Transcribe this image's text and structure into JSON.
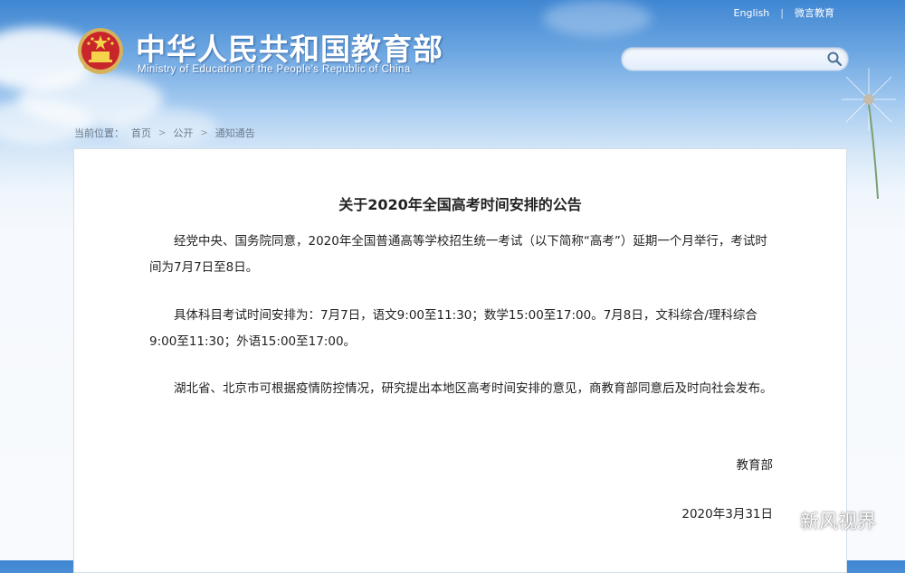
{
  "header": {
    "title_cn": "中华人民共和国教育部",
    "title_en": "Ministry of Education of the People's Republic of China",
    "english_link": "English",
    "separator": "|",
    "weibo_link": "微言教育",
    "search_placeholder": ""
  },
  "breadcrumb": {
    "label": "当前位置：",
    "items": [
      "首页",
      "公开",
      "通知通告"
    ],
    "arrow": ">"
  },
  "article": {
    "title": "关于2020年全国高考时间安排的公告",
    "paragraphs": [
      "经党中央、国务院同意，2020年全国普通高等学校招生统一考试（以下简称“高考”）延期一个月举行，考试时间为7月7日至8日。",
      "具体科目考试时间安排为：7月7日，语文9:00至11:30；数学15:00至17:00。7月8日，文科综合/理科综合9:00至11:30；外语15:00至17:00。",
      "湖北省、北京市可根据疫情防控情况，研究提出本地区高考时间安排的意见，商教育部同意后及时向社会发布。"
    ],
    "signature": "教育部",
    "date": "2020年3月31日"
  },
  "watermark": {
    "text": "新风视界",
    "icon": "wechat-icon"
  },
  "colors": {
    "sky_top": "#3f86d2",
    "sky_light": "#d7e8f8",
    "text": "#222222",
    "breadcrumb": "#6b7a8a"
  }
}
